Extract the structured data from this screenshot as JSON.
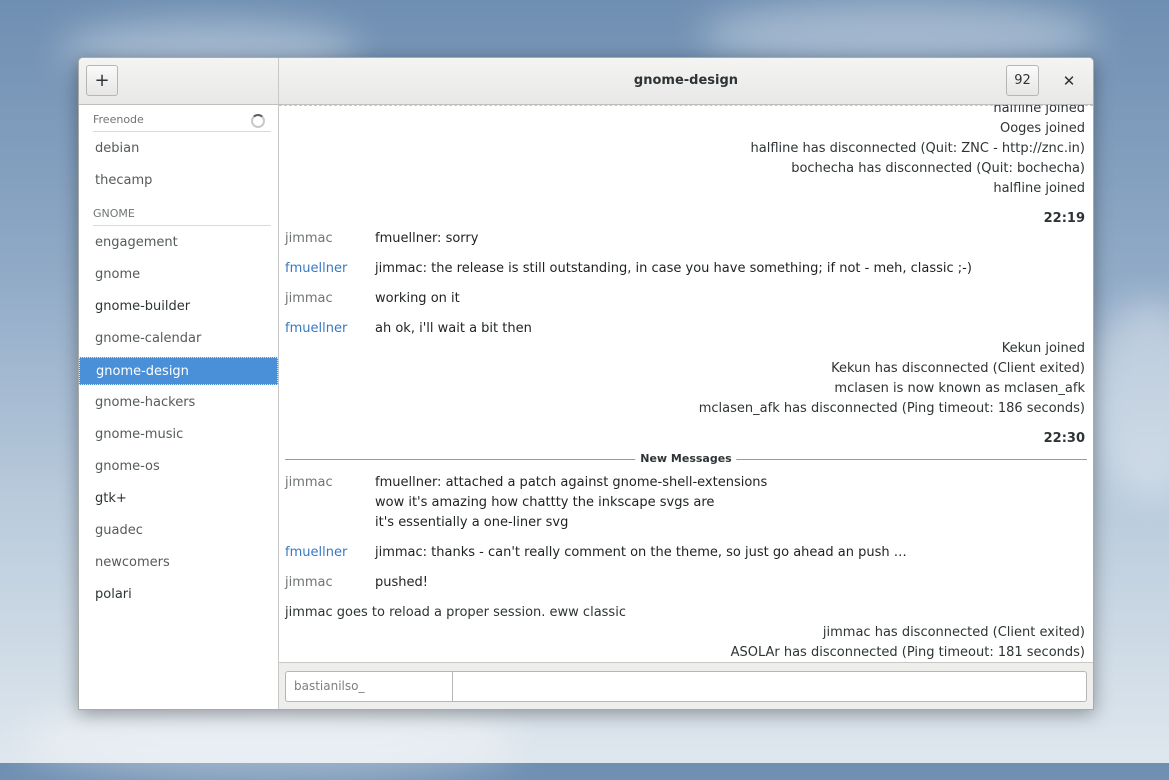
{
  "window": {
    "title": "gnome-design"
  },
  "header": {
    "add_label": "+",
    "unread_count": "92",
    "close_label": "✕"
  },
  "sidebar": {
    "networks": [
      {
        "name": "Freenode",
        "rooms": [
          "debian",
          "thecamp"
        ]
      },
      {
        "name": "GNOME",
        "rooms": [
          "engagement",
          "gnome",
          "gnome-builder",
          "gnome-calendar",
          "gnome-design",
          "gnome-hackers",
          "gnome-music",
          "gnome-os",
          "gtk+",
          "guadec",
          "newcomers",
          "polari"
        ]
      }
    ],
    "selected_room": "gnome-design"
  },
  "chat": {
    "status_top": [
      "halfline joined",
      "Ooges joined",
      "halfline has disconnected (Quit: ZNC - http://znc.in)",
      "bochecha has disconnected (Quit: bochecha)",
      "halfline joined"
    ],
    "time1": "22:19",
    "msg1_nick": "jimmac",
    "msg1_text": "fmuellner: sorry",
    "msg2_nick": "fmuellner",
    "msg2_text": "jimmac: the release is still outstanding, in case you have something; if not - meh, classic ;-)",
    "msg3_nick": "jimmac",
    "msg3_text": "working on it",
    "msg4_nick": "fmuellner",
    "msg4_text": "ah ok, i'll wait a bit then",
    "status_mid": [
      "Kekun joined",
      "Kekun has disconnected (Client exited)",
      "mclasen is now known as mclasen_afk",
      "mclasen_afk has disconnected (Ping timeout: 186 seconds)"
    ],
    "time2": "22:30",
    "new_messages_label": "New Messages",
    "msg5_nick": "jimmac",
    "msg5_lines": [
      "fmuellner: attached a patch against gnome-shell-extensions",
      "wow it's amazing how chattty the inkscape svgs are",
      "it's essentially a one-liner svg"
    ],
    "msg6_nick": "fmuellner",
    "msg6_text": "jimmac: thanks - can't really comment on the theme, so just go ahead an push …",
    "msg7_nick": "jimmac",
    "msg7_text": "pushed!",
    "action_text": "jimmac goes to reload a proper session. eww classic",
    "status_bottom": [
      "jimmac has disconnected (Client exited)",
      "ASOLAr has disconnected (Ping timeout: 181 seconds)"
    ]
  },
  "entry": {
    "nick": "bastianilso_",
    "message_value": ""
  }
}
